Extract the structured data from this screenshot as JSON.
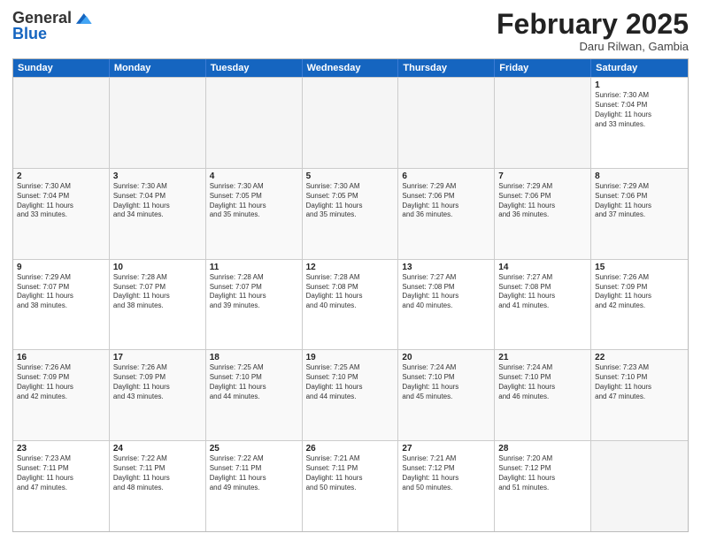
{
  "header": {
    "logo_line1": "General",
    "logo_line2": "Blue",
    "month_title": "February 2025",
    "subtitle": "Daru Rilwan, Gambia"
  },
  "weekdays": [
    "Sunday",
    "Monday",
    "Tuesday",
    "Wednesday",
    "Thursday",
    "Friday",
    "Saturday"
  ],
  "rows": [
    [
      {
        "day": "",
        "info": ""
      },
      {
        "day": "",
        "info": ""
      },
      {
        "day": "",
        "info": ""
      },
      {
        "day": "",
        "info": ""
      },
      {
        "day": "",
        "info": ""
      },
      {
        "day": "",
        "info": ""
      },
      {
        "day": "1",
        "info": "Sunrise: 7:30 AM\nSunset: 7:04 PM\nDaylight: 11 hours\nand 33 minutes."
      }
    ],
    [
      {
        "day": "2",
        "info": "Sunrise: 7:30 AM\nSunset: 7:04 PM\nDaylight: 11 hours\nand 33 minutes."
      },
      {
        "day": "3",
        "info": "Sunrise: 7:30 AM\nSunset: 7:04 PM\nDaylight: 11 hours\nand 34 minutes."
      },
      {
        "day": "4",
        "info": "Sunrise: 7:30 AM\nSunset: 7:05 PM\nDaylight: 11 hours\nand 35 minutes."
      },
      {
        "day": "5",
        "info": "Sunrise: 7:30 AM\nSunset: 7:05 PM\nDaylight: 11 hours\nand 35 minutes."
      },
      {
        "day": "6",
        "info": "Sunrise: 7:29 AM\nSunset: 7:06 PM\nDaylight: 11 hours\nand 36 minutes."
      },
      {
        "day": "7",
        "info": "Sunrise: 7:29 AM\nSunset: 7:06 PM\nDaylight: 11 hours\nand 36 minutes."
      },
      {
        "day": "8",
        "info": "Sunrise: 7:29 AM\nSunset: 7:06 PM\nDaylight: 11 hours\nand 37 minutes."
      }
    ],
    [
      {
        "day": "9",
        "info": "Sunrise: 7:29 AM\nSunset: 7:07 PM\nDaylight: 11 hours\nand 38 minutes."
      },
      {
        "day": "10",
        "info": "Sunrise: 7:28 AM\nSunset: 7:07 PM\nDaylight: 11 hours\nand 38 minutes."
      },
      {
        "day": "11",
        "info": "Sunrise: 7:28 AM\nSunset: 7:07 PM\nDaylight: 11 hours\nand 39 minutes."
      },
      {
        "day": "12",
        "info": "Sunrise: 7:28 AM\nSunset: 7:08 PM\nDaylight: 11 hours\nand 40 minutes."
      },
      {
        "day": "13",
        "info": "Sunrise: 7:27 AM\nSunset: 7:08 PM\nDaylight: 11 hours\nand 40 minutes."
      },
      {
        "day": "14",
        "info": "Sunrise: 7:27 AM\nSunset: 7:08 PM\nDaylight: 11 hours\nand 41 minutes."
      },
      {
        "day": "15",
        "info": "Sunrise: 7:26 AM\nSunset: 7:09 PM\nDaylight: 11 hours\nand 42 minutes."
      }
    ],
    [
      {
        "day": "16",
        "info": "Sunrise: 7:26 AM\nSunset: 7:09 PM\nDaylight: 11 hours\nand 42 minutes."
      },
      {
        "day": "17",
        "info": "Sunrise: 7:26 AM\nSunset: 7:09 PM\nDaylight: 11 hours\nand 43 minutes."
      },
      {
        "day": "18",
        "info": "Sunrise: 7:25 AM\nSunset: 7:10 PM\nDaylight: 11 hours\nand 44 minutes."
      },
      {
        "day": "19",
        "info": "Sunrise: 7:25 AM\nSunset: 7:10 PM\nDaylight: 11 hours\nand 44 minutes."
      },
      {
        "day": "20",
        "info": "Sunrise: 7:24 AM\nSunset: 7:10 PM\nDaylight: 11 hours\nand 45 minutes."
      },
      {
        "day": "21",
        "info": "Sunrise: 7:24 AM\nSunset: 7:10 PM\nDaylight: 11 hours\nand 46 minutes."
      },
      {
        "day": "22",
        "info": "Sunrise: 7:23 AM\nSunset: 7:10 PM\nDaylight: 11 hours\nand 47 minutes."
      }
    ],
    [
      {
        "day": "23",
        "info": "Sunrise: 7:23 AM\nSunset: 7:11 PM\nDaylight: 11 hours\nand 47 minutes."
      },
      {
        "day": "24",
        "info": "Sunrise: 7:22 AM\nSunset: 7:11 PM\nDaylight: 11 hours\nand 48 minutes."
      },
      {
        "day": "25",
        "info": "Sunrise: 7:22 AM\nSunset: 7:11 PM\nDaylight: 11 hours\nand 49 minutes."
      },
      {
        "day": "26",
        "info": "Sunrise: 7:21 AM\nSunset: 7:11 PM\nDaylight: 11 hours\nand 50 minutes."
      },
      {
        "day": "27",
        "info": "Sunrise: 7:21 AM\nSunset: 7:12 PM\nDaylight: 11 hours\nand 50 minutes."
      },
      {
        "day": "28",
        "info": "Sunrise: 7:20 AM\nSunset: 7:12 PM\nDaylight: 11 hours\nand 51 minutes."
      },
      {
        "day": "",
        "info": ""
      }
    ]
  ]
}
